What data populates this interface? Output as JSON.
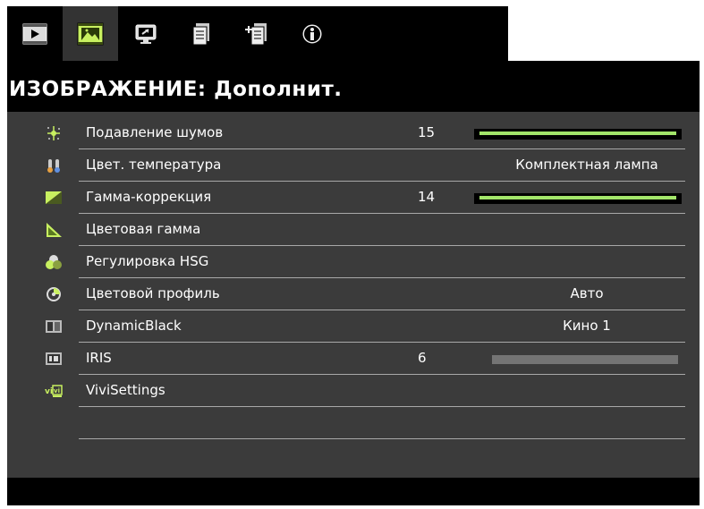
{
  "tabs": [
    {
      "name": "tab-video-icon",
      "icon": "play-icon"
    },
    {
      "name": "tab-picture-icon",
      "icon": "picture-icon"
    },
    {
      "name": "tab-display-icon",
      "icon": "monitor-icon"
    },
    {
      "name": "tab-settings-icon",
      "icon": "document-icon"
    },
    {
      "name": "tab-advanced-icon",
      "icon": "documents-plus-icon"
    },
    {
      "name": "tab-info-icon",
      "icon": "info-icon"
    }
  ],
  "active_tab": 1,
  "title": "ИЗОБРАЖЕНИЕ: Дополнит.",
  "menu": [
    {
      "label": "Подавление шумов",
      "value": "15",
      "slider": 1.0,
      "icon": "noise-reduction-icon"
    },
    {
      "label": "Цвет. температура",
      "option": "Комплектная лампа",
      "icon": "thermometer-icon"
    },
    {
      "label": "Гамма-коррекция",
      "value": "14",
      "slider": 1.0,
      "icon": "gamma-icon"
    },
    {
      "label": "Цветовая гамма",
      "icon": "color-gamut-icon"
    },
    {
      "label": "Регулировка HSG",
      "icon": "hsg-icon"
    },
    {
      "label": "Цветовой профиль",
      "option": "Авто",
      "icon": "color-profile-icon"
    },
    {
      "label": "DynamicBlack",
      "option": "Кино 1",
      "icon": "dynamic-black-icon"
    },
    {
      "label": "IRIS",
      "value": "6",
      "slider_disabled": true,
      "icon": "iris-icon"
    },
    {
      "label": "ViviSettings",
      "icon": "vivisettings-icon"
    }
  ],
  "colors": {
    "background": "#3b3b3b",
    "title_bar": "#000000",
    "slider_fill": "#a3e66a",
    "disabled_slider": "#747474",
    "active_tab_icon": "#c8f060"
  }
}
